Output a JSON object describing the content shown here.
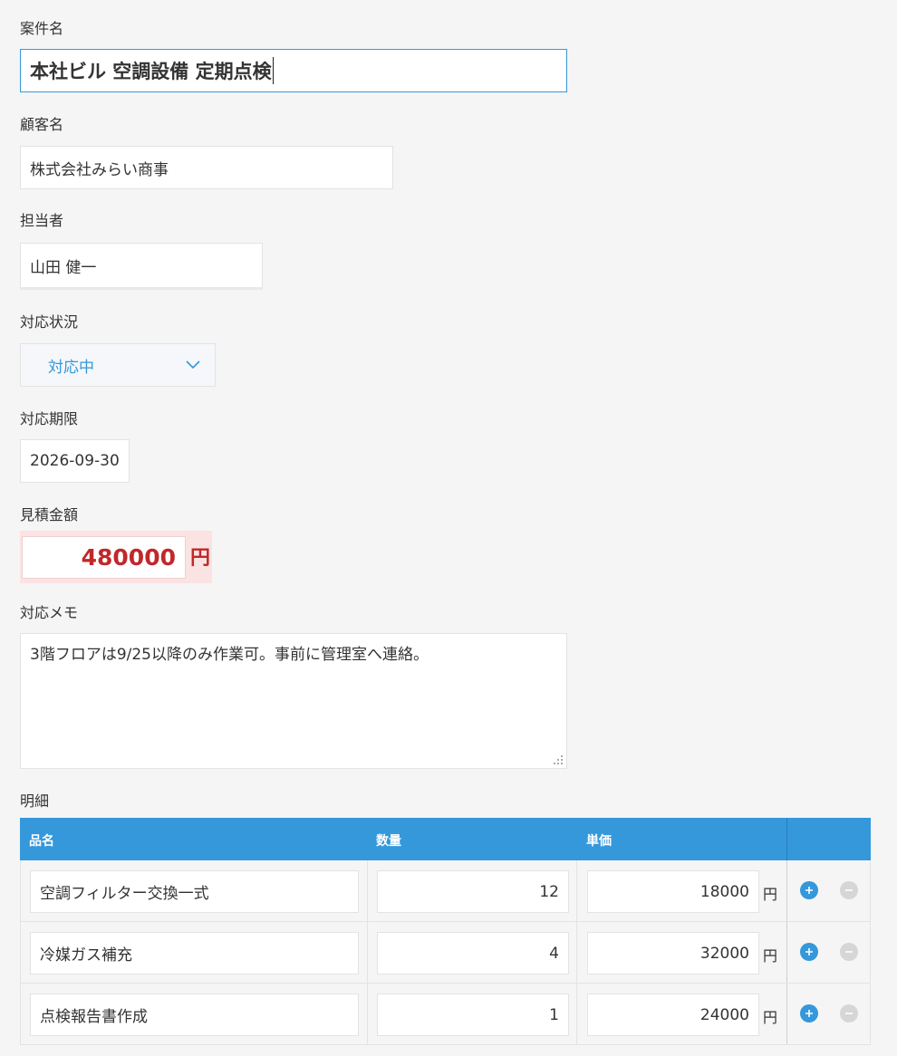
{
  "fields": {
    "title": {
      "label": "案件名",
      "value": "本社ビル 空調設備 定期点検"
    },
    "customer": {
      "label": "顧客名",
      "value": "株式会社みらい商事"
    },
    "assignee": {
      "label": "担当者",
      "value": "山田 健一"
    },
    "status": {
      "label": "対応状況",
      "value": "対応中"
    },
    "deadline": {
      "label": "対応期限",
      "value": "2026-09-30"
    },
    "amount": {
      "label": "見積金額",
      "value": "480000",
      "unit": "円"
    },
    "memo": {
      "label": "対応メモ",
      "value": "3階フロアは9/25以降のみ作業可。事前に管理室へ連絡。"
    }
  },
  "details": {
    "label": "明細",
    "headers": {
      "item": "品名",
      "qty": "数量",
      "price": "単価"
    },
    "unit": "円",
    "rows": [
      {
        "item": "空調フィルター交換一式",
        "qty": "12",
        "price": "18000"
      },
      {
        "item": "冷媒ガス補充",
        "qty": "4",
        "price": "32000"
      },
      {
        "item": "点検報告書作成",
        "qty": "1",
        "price": "24000"
      }
    ]
  },
  "colors": {
    "accent": "#3498db",
    "amount_text": "#c0282b",
    "amount_bg": "#fbe3e3",
    "table_header": "#3498db"
  },
  "icons": {
    "status_dropdown": "chevron-down-icon",
    "add_row": "plus-circle-icon",
    "remove_row": "minus-circle-icon",
    "resize": "resize-grip-icon"
  }
}
